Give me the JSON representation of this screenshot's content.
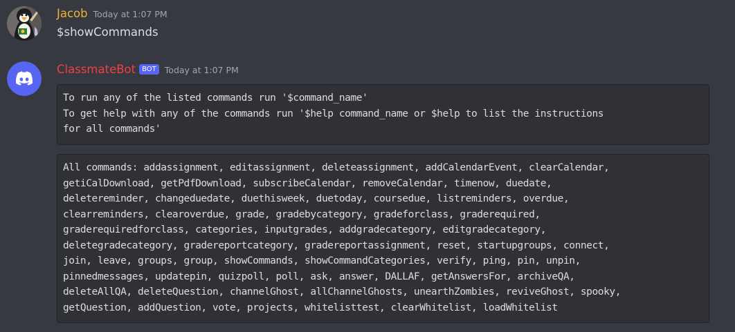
{
  "messages": [
    {
      "author": "Jacob",
      "author_color": "#f0b232",
      "timestamp": "Today at 1:07 PM",
      "avatar_icon": "penguin-avatar-icon",
      "content": "$showCommands"
    },
    {
      "author": "ClassmateBot",
      "author_color": "#ed4245",
      "bot_tag": "BOT",
      "timestamp": "Today at 1:07 PM",
      "avatar_icon": "discord-logo-icon",
      "code_blocks": [
        {
          "lines": [
            "To run any of the listed commands run '$command_name'",
            "To get help with any of the commands run '$help command_name or $help to list the instructions",
            "for all commands'"
          ]
        },
        {
          "lines": [
            "All commands: addassignment, editassignment, deleteassignment, addCalendarEvent, clearCalendar,",
            "getiCalDownload, getPdfDownload, subscribeCalendar, removeCalendar, timenow, duedate,",
            "deletereminder, changeduedate, duethisweek, duetoday, coursedue, listreminders, overdue,",
            "clearreminders, clearoverdue, grade, gradebycategory, gradeforclass, graderequired,",
            "graderequiredforclass, categories, inputgrades, addgradecategory, editgradecategory,",
            "deletegradecategory, gradereportcategory, gradereportassignment, reset, startupgroups, connect,",
            "join, leave, groups, group, showCommands, showCommandCategories, verify, ping, pin, unpin,",
            "pinnedmessages, updatepin, quizpoll, poll, ask, answer, DALLAF, getAnswersFor, archiveQA,",
            "deleteAllQA, deleteQuestion, channelGhost, allChannelGhosts, unearthZombies, reviveGhost, spooky,",
            "getQuestion, addQuestion, vote, projects, whitelisttest, clearWhitelist, loadWhitelist"
          ]
        }
      ]
    }
  ],
  "colors": {
    "background": "#36393f",
    "code_background": "#2f3136",
    "bot_tag": "#5865f2",
    "discord_blurple": "#5865f2"
  }
}
